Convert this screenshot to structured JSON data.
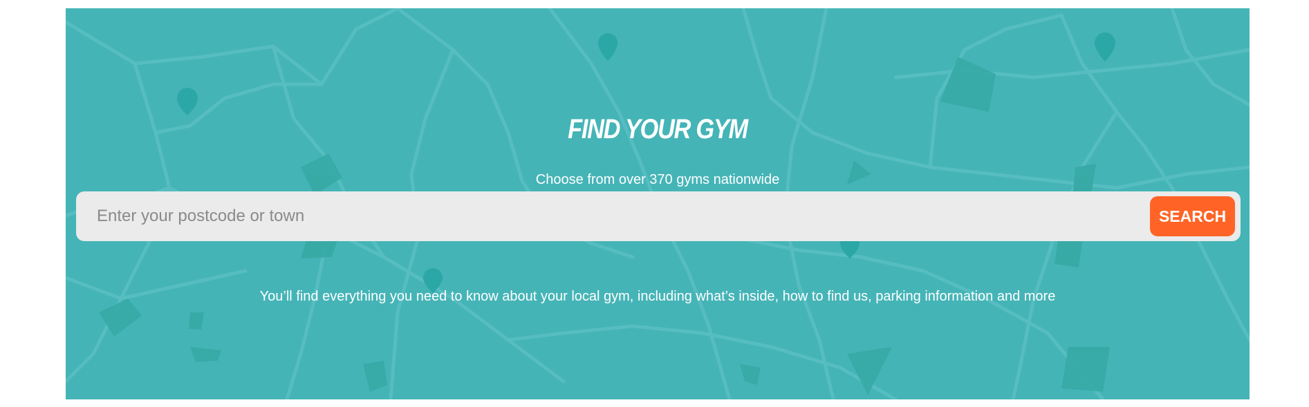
{
  "hero": {
    "title": "FIND YOUR GYM",
    "subtitle": "Choose from over 370 gyms nationwide",
    "description": "You’ll find everything you need to know about your local gym, including what’s inside, how to find us, parking information and more",
    "background_color": "#45b4b7"
  },
  "search": {
    "placeholder": "Enter your postcode or town",
    "value": "",
    "button_label": "SEARCH",
    "button_color": "#ff6426"
  },
  "icons": {
    "map_background": "map-pattern",
    "map_pins": "map-pin-icon"
  }
}
